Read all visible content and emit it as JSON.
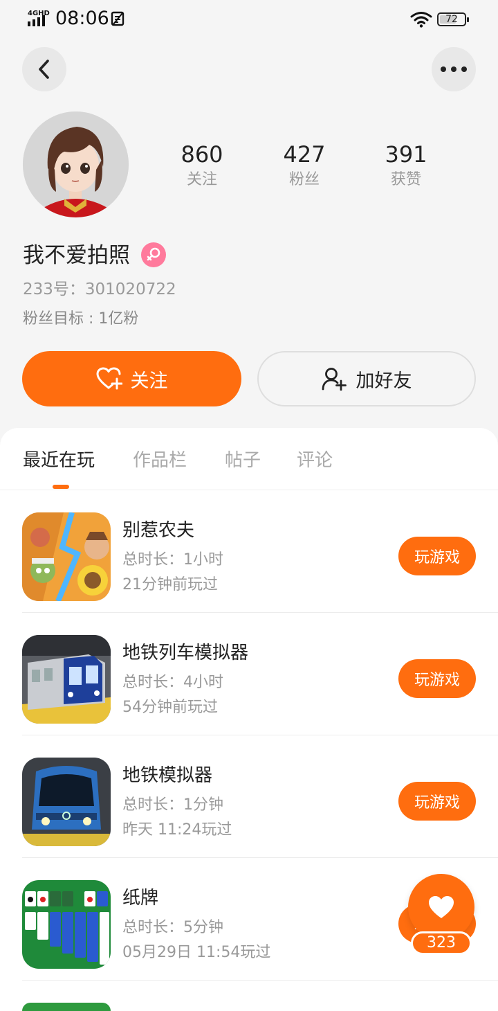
{
  "status_bar": {
    "network": "4GHD",
    "time": "08:06",
    "battery": "72",
    "battery_level": 0.72
  },
  "header": {
    "back_icon": "chevron-left-icon",
    "more_icon": "more-horizontal-icon"
  },
  "profile": {
    "stats": [
      {
        "value": "860",
        "label": "关注"
      },
      {
        "value": "427",
        "label": "粉丝"
      },
      {
        "value": "391",
        "label": "获赞"
      }
    ],
    "username": "我不爱拍照",
    "gender_icon": "female-icon",
    "uid": "233号：301020722",
    "goal": "粉丝目标 : 1亿粉"
  },
  "actions": {
    "follow_label": "关注",
    "add_friend_label": "加好友"
  },
  "tabs": [
    {
      "label": "最近在玩",
      "active": true
    },
    {
      "label": "作品栏",
      "active": false
    },
    {
      "label": "帖子",
      "active": false
    },
    {
      "label": "评论",
      "active": false
    }
  ],
  "games": [
    {
      "title": "别惹农夫",
      "duration": "总时长：1小时",
      "last_played": "21分钟前玩过",
      "button": "玩游戏"
    },
    {
      "title": "地铁列车模拟器",
      "duration": "总时长：4小时",
      "last_played": "54分钟前玩过",
      "button": "玩游戏"
    },
    {
      "title": "地铁模拟器",
      "duration": "总时长：1分钟",
      "last_played": "昨天 11:24玩过",
      "button": "玩游戏"
    },
    {
      "title": "纸牌",
      "duration": "总时长：5分钟",
      "last_played": "05月29日 11:54玩过",
      "button": "玩游戏"
    }
  ],
  "floating_like": {
    "count": "323",
    "icon": "heart-icon"
  },
  "colors": {
    "accent": "#ff6d0f",
    "female": "#ff7a9c",
    "background": "#f5f5f5"
  }
}
